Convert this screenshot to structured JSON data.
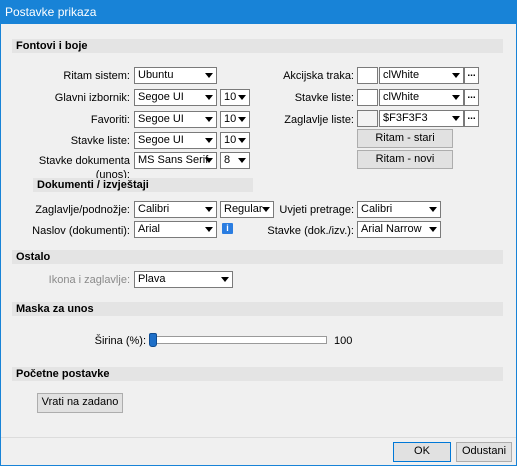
{
  "window": {
    "title": "Postavke prikaza"
  },
  "sections": {
    "fonts": "Fontovi i boje",
    "documents": "Dokumenti / izvještaji",
    "other": "Ostalo",
    "mask": "Maska za unos",
    "initial": "Početne postavke"
  },
  "fonts": {
    "rhythm_system": {
      "label": "Ritam sistem:",
      "value": "Ubuntu"
    },
    "main_menu": {
      "label": "Glavni izbornik:",
      "value": "Segoe UI",
      "size": "10"
    },
    "favorites": {
      "label": "Favoriti:",
      "value": "Segoe UI",
      "size": "10"
    },
    "list_items": {
      "label": "Stavke liste:",
      "value": "Segoe UI",
      "size": "10"
    },
    "doc_items": {
      "label": "Stavke dokumenta (unos):",
      "value": "MS Sans Serif",
      "size": "8"
    }
  },
  "colors": {
    "action_bar": {
      "label": "Akcijska traka:",
      "value": "clWhite",
      "swatch": "#ffffff"
    },
    "list_items": {
      "label": "Stavke liste:",
      "value": "clWhite",
      "swatch": "#ffffff"
    },
    "list_header": {
      "label": "Zaglavlje liste:",
      "value": "$F3F3F3",
      "swatch": "#f3f3f3"
    },
    "rhythm_old_button": "Ritam - stari",
    "rhythm_new_button": "Ritam - novi",
    "ellipsis": "..."
  },
  "documents": {
    "header_footer": {
      "label": "Zaglavlje/podnožje:",
      "value": "Calibri",
      "style": "Regular"
    },
    "title": {
      "label": "Naslov (dokumenti):",
      "value": "Arial"
    },
    "search_conditions": {
      "label": "Uvjeti pretrage:",
      "value": "Calibri"
    },
    "items": {
      "label": "Stavke (dok./izv.):",
      "value": "Arial Narrow"
    },
    "info_icon": "i"
  },
  "other": {
    "icon_header": {
      "label": "Ikona i zaglavlje:",
      "value": "Plava"
    }
  },
  "mask": {
    "width_label": "Širina (%):",
    "width_value": "100",
    "width_fraction": 0.0
  },
  "initial": {
    "reset_button": "Vrati na zadano"
  },
  "footer": {
    "ok": "OK",
    "cancel": "Odustani"
  }
}
